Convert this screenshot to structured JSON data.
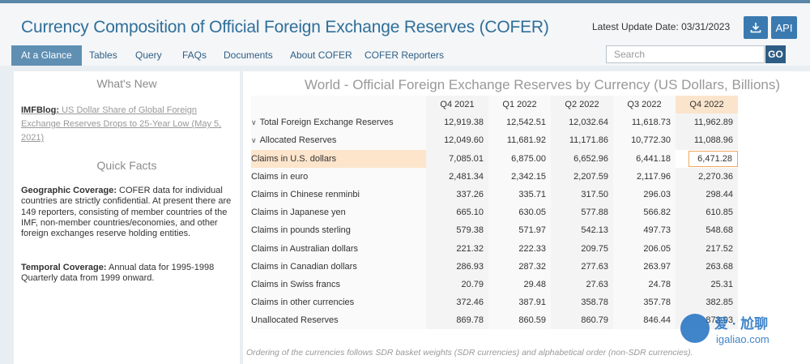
{
  "header": {
    "title": "Currency Composition of Official Foreign Exchange Reserves (COFER)",
    "update_label": "Latest Update Date: 03/31/2023",
    "download_icon": "download-icon",
    "api_label": "API"
  },
  "nav": {
    "items": [
      "At a Glance",
      "Tables",
      "Query",
      "FAQs",
      "Documents",
      "About COFER",
      "COFER Reporters"
    ],
    "active": "At a Glance"
  },
  "search": {
    "placeholder": "Search",
    "go_label": "GO"
  },
  "sidebar": {
    "whats_new_title": "What's New",
    "blog_prefix": "IMFBlog:",
    "blog_text": " US Dollar Share of Global Foreign Exchange Reserves Drops to 25-Year Low (May 5, 2021)",
    "quick_facts_title": "Quick Facts",
    "geo_label": "Geographic Coverage:",
    "geo_text": " COFER data for individual countries are strictly confidential. At present there are 149 reporters, consisting of member countries of the IMF, non-member countries/economies, and other foreign exchanges reserve holding entities.",
    "temporal_label": "Temporal Coverage:",
    "temporal_text": " Annual data for 1995-1998 Quarterly data from 1999 onward."
  },
  "main": {
    "title": "World - Official Foreign Exchange Reserves by Currency (US Dollars, Billions)",
    "columns": [
      "Q4 2021",
      "Q1 2022",
      "Q2 2022",
      "Q3 2022",
      "Q4 2022"
    ],
    "rows": [
      {
        "label": "Total Foreign Exchange Reserves",
        "values": [
          "12,919.38",
          "12,542.51",
          "12,032.64",
          "11,618.73",
          "11,962.89"
        ]
      },
      {
        "label": "Allocated Reserves",
        "values": [
          "12,049.60",
          "11,681.92",
          "11,171.86",
          "10,772.30",
          "11,088.96"
        ]
      },
      {
        "label": "Claims in U.S. dollars",
        "values": [
          "7,085.01",
          "6,875.00",
          "6,652.96",
          "6,441.18",
          "6,471.28"
        ]
      },
      {
        "label": "Claims in euro",
        "values": [
          "2,481.34",
          "2,342.15",
          "2,207.59",
          "2,117.96",
          "2,270.36"
        ]
      },
      {
        "label": "Claims in Chinese renminbi",
        "values": [
          "337.26",
          "335.71",
          "317.50",
          "296.03",
          "298.44"
        ]
      },
      {
        "label": "Claims in Japanese yen",
        "values": [
          "665.10",
          "630.05",
          "577.88",
          "566.82",
          "610.85"
        ]
      },
      {
        "label": "Claims in pounds sterling",
        "values": [
          "579.38",
          "571.97",
          "542.13",
          "497.73",
          "548.68"
        ]
      },
      {
        "label": "Claims in Australian dollars",
        "values": [
          "221.32",
          "222.33",
          "209.75",
          "206.05",
          "217.52"
        ]
      },
      {
        "label": "Claims in Canadian dollars",
        "values": [
          "286.93",
          "287.32",
          "277.63",
          "263.97",
          "263.68"
        ]
      },
      {
        "label": "Claims in Swiss francs",
        "values": [
          "20.79",
          "29.48",
          "27.63",
          "24.78",
          "25.31"
        ]
      },
      {
        "label": "Claims in other currencies",
        "values": [
          "372.46",
          "387.91",
          "358.78",
          "357.78",
          "382.85"
        ]
      },
      {
        "label": "Unallocated Reserves",
        "values": [
          "869.78",
          "860.59",
          "860.79",
          "846.44",
          "873.93"
        ]
      }
    ],
    "footnote": "Ordering of the currencies follows SDR basket weights (SDR currencies) and alphabetical order (non-SDR currencies)."
  },
  "watermark": {
    "text": "爱 · 尬聊",
    "url": "igaliao.com"
  }
}
